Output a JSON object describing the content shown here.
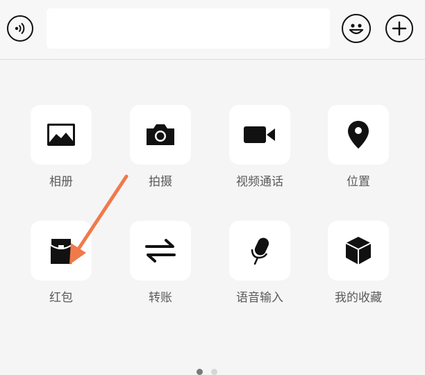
{
  "input": {
    "value": "",
    "placeholder": ""
  },
  "toolbar": {
    "voice_icon": "voice-icon",
    "emoji_icon": "emoji-icon",
    "plus_icon": "plus-icon"
  },
  "panel": {
    "items": [
      {
        "label": "相册",
        "icon": "album-icon"
      },
      {
        "label": "拍摄",
        "icon": "camera-icon"
      },
      {
        "label": "视频通话",
        "icon": "video-call-icon"
      },
      {
        "label": "位置",
        "icon": "location-icon"
      },
      {
        "label": "红包",
        "icon": "red-packet-icon"
      },
      {
        "label": "转账",
        "icon": "transfer-icon"
      },
      {
        "label": "语音输入",
        "icon": "microphone-icon"
      },
      {
        "label": "我的收藏",
        "icon": "favorites-icon"
      }
    ],
    "pager": {
      "current_page": 1,
      "total_pages": 2
    }
  },
  "annotation": {
    "arrow_color": "#f07a4a"
  }
}
